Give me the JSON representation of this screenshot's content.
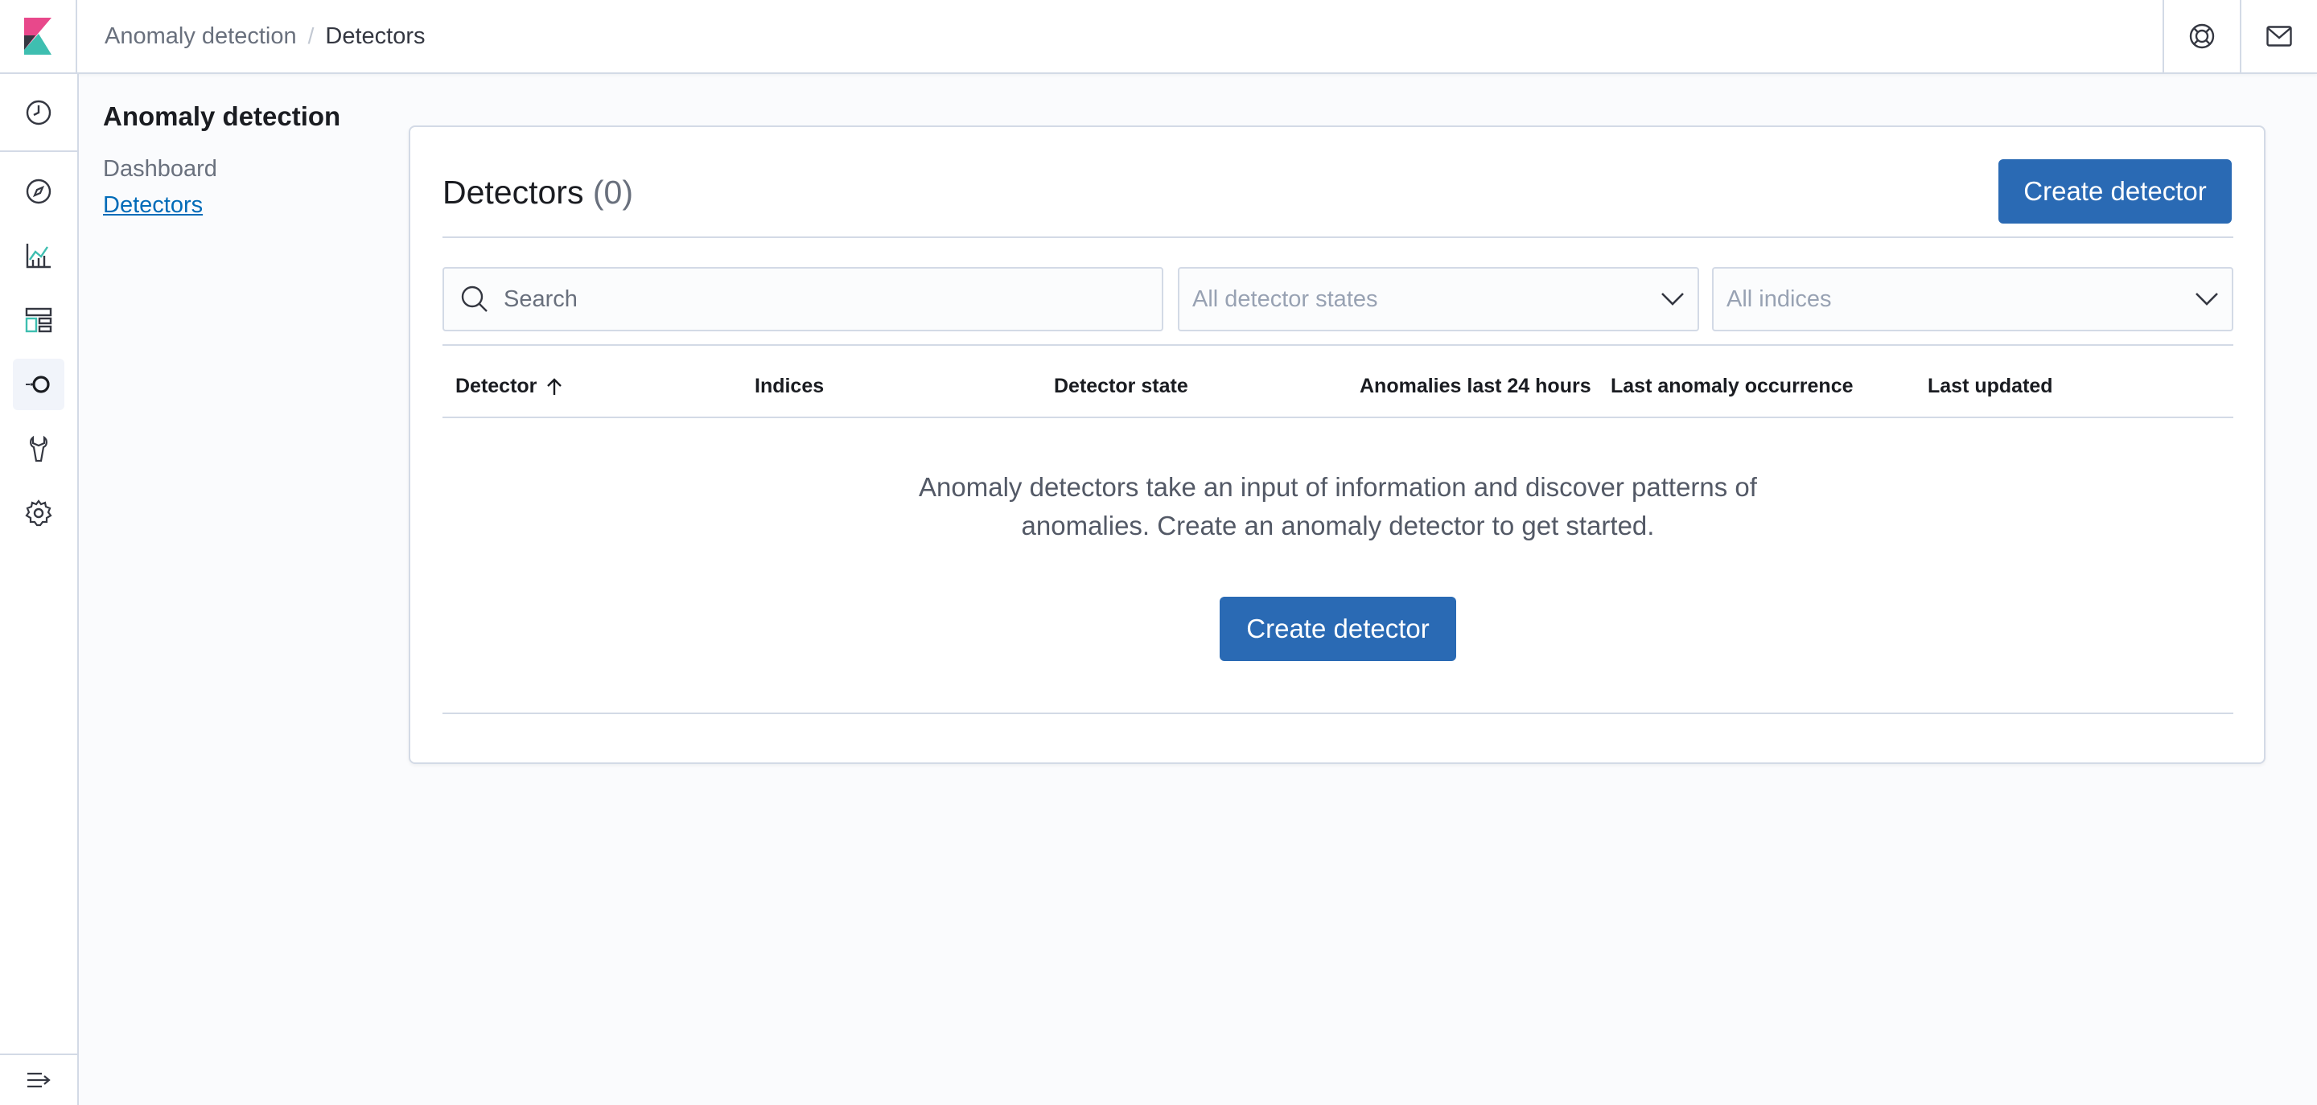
{
  "breadcrumbs": {
    "parent": "Anomaly detection",
    "current": "Detectors"
  },
  "subnav": {
    "title": "Anomaly detection",
    "items": [
      "Dashboard",
      "Detectors"
    ],
    "selected": "Detectors"
  },
  "panel": {
    "title": "Detectors",
    "count": "(0)",
    "create_label": "Create detector"
  },
  "filters": {
    "search_placeholder": "Search",
    "state_select": "All detector states",
    "indices_select": "All indices"
  },
  "table": {
    "columns": [
      "Detector",
      "Indices",
      "Detector state",
      "Anomalies last 24 hours",
      "Last anomaly occurrence",
      "Last updated"
    ],
    "sort_column": "Detector",
    "sort_direction": "ascending"
  },
  "empty_state": {
    "line1": "Anomaly detectors take an input of information and discover patterns of",
    "line2": "anomalies. Create an anomaly detector to get started.",
    "button_label": "Create detector"
  },
  "colors": {
    "primary": "#2a6ab4",
    "link": "#006bb8",
    "border": "#d3dae6",
    "logo_pink": "#e8488b",
    "logo_teal": "#3ebeb0"
  }
}
